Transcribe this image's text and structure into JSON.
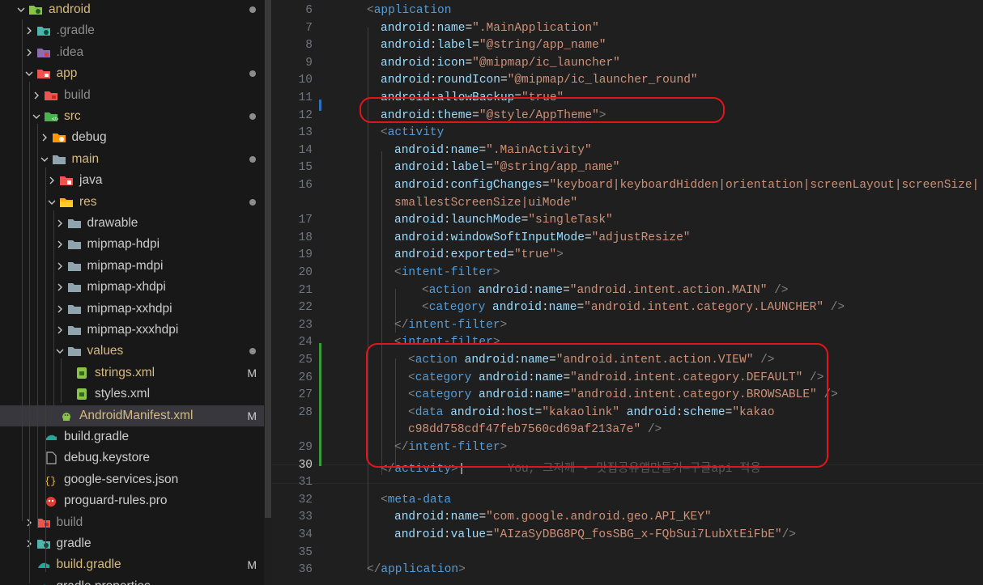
{
  "explorer": {
    "items": [
      {
        "label": "android",
        "color": "#d7ba7d",
        "expanded": true,
        "icon": "android-folder-icon",
        "dot": true
      },
      {
        "label": ".gradle",
        "color": "#8c8c8c",
        "expanded": false,
        "icon": "gradle-folder-icon"
      },
      {
        "label": ".idea",
        "color": "#8c8c8c",
        "expanded": false,
        "icon": "idea-folder-icon"
      },
      {
        "label": "app",
        "color": "#d7ba7d",
        "expanded": true,
        "icon": "app-folder-icon",
        "dot": true
      },
      {
        "label": "build",
        "color": "#8c8c8c",
        "expanded": false,
        "icon": "build-folder-icon"
      },
      {
        "label": "src",
        "color": "#d7ba7d",
        "expanded": true,
        "icon": "src-folder-icon",
        "dot": true
      },
      {
        "label": "debug",
        "color": "#cccccc",
        "expanded": false,
        "icon": "debug-folder-icon"
      },
      {
        "label": "main",
        "color": "#d7ba7d",
        "expanded": true,
        "icon": "folder-icon",
        "dot": true
      },
      {
        "label": "java",
        "color": "#cccccc",
        "expanded": false,
        "icon": "java-folder-icon"
      },
      {
        "label": "res",
        "color": "#d7ba7d",
        "expanded": true,
        "icon": "res-folder-icon",
        "dot": true
      },
      {
        "label": "drawable",
        "color": "#cccccc",
        "expanded": false,
        "icon": "folder-icon"
      },
      {
        "label": "mipmap-hdpi",
        "color": "#cccccc",
        "expanded": false,
        "icon": "folder-icon"
      },
      {
        "label": "mipmap-mdpi",
        "color": "#cccccc",
        "expanded": false,
        "icon": "folder-icon"
      },
      {
        "label": "mipmap-xhdpi",
        "color": "#cccccc",
        "expanded": false,
        "icon": "folder-icon"
      },
      {
        "label": "mipmap-xxhdpi",
        "color": "#cccccc",
        "expanded": false,
        "icon": "folder-icon"
      },
      {
        "label": "mipmap-xxxhdpi",
        "color": "#cccccc",
        "expanded": false,
        "icon": "folder-icon"
      },
      {
        "label": "values",
        "color": "#d7ba7d",
        "expanded": true,
        "icon": "folder-icon",
        "dot": true
      },
      {
        "label": "strings.xml",
        "color": "#d7ba7d",
        "icon": "xml-file-icon",
        "mod": "M"
      },
      {
        "label": "styles.xml",
        "color": "#cccccc",
        "icon": "xml-file-icon"
      },
      {
        "label": "AndroidManifest.xml",
        "color": "#d7ba7d",
        "icon": "android-file-icon",
        "mod": "M",
        "selected": true
      },
      {
        "label": "build.gradle",
        "color": "#cccccc",
        "icon": "gradle-file-icon"
      },
      {
        "label": "debug.keystore",
        "color": "#cccccc",
        "icon": "file-icon"
      },
      {
        "label": "google-services.json",
        "color": "#cccccc",
        "icon": "json-file-icon"
      },
      {
        "label": "proguard-rules.pro",
        "color": "#cccccc",
        "icon": "proguard-file-icon"
      },
      {
        "label": "build",
        "color": "#8c8c8c",
        "expanded": false,
        "icon": "build-folder-icon"
      },
      {
        "label": "gradle",
        "color": "#cccccc",
        "expanded": false,
        "icon": "gradle-folder-icon"
      },
      {
        "label": "build.gradle",
        "color": "#d7ba7d",
        "icon": "gradle-file-icon",
        "mod": "M"
      },
      {
        "label": "gradle.properties",
        "color": "#cccccc",
        "icon": "gradle-file-icon"
      }
    ]
  },
  "editor": {
    "current_line": "30",
    "blame": "You, 그저께 • 맛집공유앱만들기—구글api 적용",
    "lines": [
      {
        "n": "6",
        "tokens": [
          [
            "br",
            "<"
          ],
          [
            "tag",
            "application"
          ]
        ]
      },
      {
        "n": "7",
        "tokens": [
          [
            "ns",
            "android"
          ],
          [
            "eq",
            ":"
          ],
          [
            "attr",
            "name"
          ],
          [
            "eq",
            "="
          ],
          [
            "str",
            "\".MainApplication\""
          ]
        ]
      },
      {
        "n": "8",
        "tokens": [
          [
            "ns",
            "android"
          ],
          [
            "eq",
            ":"
          ],
          [
            "attr",
            "label"
          ],
          [
            "eq",
            "="
          ],
          [
            "str",
            "\"@string/app_name\""
          ]
        ]
      },
      {
        "n": "9",
        "tokens": [
          [
            "ns",
            "android"
          ],
          [
            "eq",
            ":"
          ],
          [
            "attr",
            "icon"
          ],
          [
            "eq",
            "="
          ],
          [
            "str",
            "\"@mipmap/ic_launcher\""
          ]
        ]
      },
      {
        "n": "10",
        "tokens": [
          [
            "ns",
            "android"
          ],
          [
            "eq",
            ":"
          ],
          [
            "attr",
            "roundIcon"
          ],
          [
            "eq",
            "="
          ],
          [
            "str",
            "\"@mipmap/ic_launcher_round\""
          ]
        ]
      },
      {
        "n": "11",
        "tokens": [
          [
            "ns",
            "android"
          ],
          [
            "eq",
            ":"
          ],
          [
            "attr",
            "allowBackup"
          ],
          [
            "eq",
            "="
          ],
          [
            "str",
            "\"true\""
          ]
        ]
      },
      {
        "n": "12",
        "tokens": [
          [
            "ns",
            "android"
          ],
          [
            "eq",
            ":"
          ],
          [
            "attr",
            "theme"
          ],
          [
            "eq",
            "="
          ],
          [
            "str",
            "\"@style/AppTheme\""
          ],
          [
            "br",
            ">"
          ]
        ]
      },
      {
        "n": "13",
        "tokens": [
          [
            "br",
            "<"
          ],
          [
            "tag",
            "activity"
          ]
        ]
      },
      {
        "n": "14",
        "tokens": [
          [
            "ns",
            "android"
          ],
          [
            "eq",
            ":"
          ],
          [
            "attr",
            "name"
          ],
          [
            "eq",
            "="
          ],
          [
            "str",
            "\".MainActivity\""
          ]
        ]
      },
      {
        "n": "15",
        "tokens": [
          [
            "ns",
            "android"
          ],
          [
            "eq",
            ":"
          ],
          [
            "attr",
            "label"
          ],
          [
            "eq",
            "="
          ],
          [
            "str",
            "\"@string/app_name\""
          ]
        ]
      },
      {
        "n": "16",
        "tokens": [
          [
            "ns",
            "android"
          ],
          [
            "eq",
            ":"
          ],
          [
            "attr",
            "configChanges"
          ],
          [
            "eq",
            "="
          ],
          [
            "str",
            "\"keyboard|keyboardHidden|orientation|screenLayout|screenSize|"
          ]
        ]
      },
      {
        "n": "",
        "tokens": [
          [
            "str",
            "smallestScreenSize|uiMode\""
          ]
        ]
      },
      {
        "n": "17",
        "tokens": [
          [
            "ns",
            "android"
          ],
          [
            "eq",
            ":"
          ],
          [
            "attr",
            "launchMode"
          ],
          [
            "eq",
            "="
          ],
          [
            "str",
            "\"singleTask\""
          ]
        ]
      },
      {
        "n": "18",
        "tokens": [
          [
            "ns",
            "android"
          ],
          [
            "eq",
            ":"
          ],
          [
            "attr",
            "windowSoftInputMode"
          ],
          [
            "eq",
            "="
          ],
          [
            "str",
            "\"adjustResize\""
          ]
        ]
      },
      {
        "n": "19",
        "tokens": [
          [
            "ns",
            "android"
          ],
          [
            "eq",
            ":"
          ],
          [
            "attr",
            "exported"
          ],
          [
            "eq",
            "="
          ],
          [
            "str",
            "\"true\""
          ],
          [
            "br",
            ">"
          ]
        ]
      },
      {
        "n": "20",
        "tokens": [
          [
            "br",
            "<"
          ],
          [
            "tag",
            "intent-filter"
          ],
          [
            "br",
            ">"
          ]
        ]
      },
      {
        "n": "21",
        "tokens": [
          [
            "br",
            "<"
          ],
          [
            "tag",
            "action"
          ],
          [
            "eq",
            " "
          ],
          [
            "ns",
            "android"
          ],
          [
            "eq",
            ":"
          ],
          [
            "attr",
            "name"
          ],
          [
            "eq",
            "="
          ],
          [
            "str",
            "\"android.intent.action.MAIN\""
          ],
          [
            "eq",
            " "
          ],
          [
            "br",
            "/>"
          ]
        ]
      },
      {
        "n": "22",
        "tokens": [
          [
            "br",
            "<"
          ],
          [
            "tag",
            "category"
          ],
          [
            "eq",
            " "
          ],
          [
            "ns",
            "android"
          ],
          [
            "eq",
            ":"
          ],
          [
            "attr",
            "name"
          ],
          [
            "eq",
            "="
          ],
          [
            "str",
            "\"android.intent.category.LAUNCHER\""
          ],
          [
            "eq",
            " "
          ],
          [
            "br",
            "/>"
          ]
        ]
      },
      {
        "n": "23",
        "tokens": [
          [
            "br",
            "</"
          ],
          [
            "tag",
            "intent-filter"
          ],
          [
            "br",
            ">"
          ]
        ]
      },
      {
        "n": "24",
        "tokens": [
          [
            "br",
            "<"
          ],
          [
            "tag",
            "intent-filter"
          ],
          [
            "br",
            ">"
          ]
        ]
      },
      {
        "n": "25",
        "tokens": [
          [
            "br",
            "<"
          ],
          [
            "tag",
            "action"
          ],
          [
            "eq",
            " "
          ],
          [
            "ns",
            "android"
          ],
          [
            "eq",
            ":"
          ],
          [
            "attr",
            "name"
          ],
          [
            "eq",
            "="
          ],
          [
            "str",
            "\"android.intent.action.VIEW\""
          ],
          [
            "eq",
            " "
          ],
          [
            "br",
            "/>"
          ]
        ]
      },
      {
        "n": "26",
        "tokens": [
          [
            "br",
            "<"
          ],
          [
            "tag",
            "category"
          ],
          [
            "eq",
            " "
          ],
          [
            "ns",
            "android"
          ],
          [
            "eq",
            ":"
          ],
          [
            "attr",
            "name"
          ],
          [
            "eq",
            "="
          ],
          [
            "str",
            "\"android.intent.category.DEFAULT\""
          ],
          [
            "eq",
            " "
          ],
          [
            "br",
            "/>"
          ]
        ]
      },
      {
        "n": "27",
        "tokens": [
          [
            "br",
            "<"
          ],
          [
            "tag",
            "category"
          ],
          [
            "eq",
            " "
          ],
          [
            "ns",
            "android"
          ],
          [
            "eq",
            ":"
          ],
          [
            "attr",
            "name"
          ],
          [
            "eq",
            "="
          ],
          [
            "str",
            "\"android.intent.category.BROWSABLE\""
          ],
          [
            "eq",
            " "
          ],
          [
            "br",
            "/>"
          ]
        ]
      },
      {
        "n": "28",
        "tokens": [
          [
            "br",
            "<"
          ],
          [
            "tag",
            "data"
          ],
          [
            "eq",
            " "
          ],
          [
            "ns",
            "android"
          ],
          [
            "eq",
            ":"
          ],
          [
            "attr",
            "host"
          ],
          [
            "eq",
            "="
          ],
          [
            "str",
            "\"kakaolink\""
          ],
          [
            "eq",
            " "
          ],
          [
            "ns",
            "android"
          ],
          [
            "eq",
            ":"
          ],
          [
            "attr",
            "scheme"
          ],
          [
            "eq",
            "="
          ],
          [
            "str",
            "\"kakao"
          ]
        ]
      },
      {
        "n": "",
        "tokens": [
          [
            "str",
            "c98dd758cdf47feb7560cd69af213a7e\""
          ],
          [
            "eq",
            " "
          ],
          [
            "br",
            "/>"
          ]
        ]
      },
      {
        "n": "29",
        "tokens": [
          [
            "br",
            "</"
          ],
          [
            "tag",
            "intent-filter"
          ],
          [
            "br",
            ">"
          ]
        ]
      },
      {
        "n": "30",
        "tokens": [
          [
            "br",
            "</"
          ],
          [
            "tag",
            "activity"
          ],
          [
            "br",
            ">"
          ]
        ]
      },
      {
        "n": "31",
        "tokens": []
      },
      {
        "n": "32",
        "tokens": [
          [
            "br",
            "<"
          ],
          [
            "tag",
            "meta-data"
          ]
        ]
      },
      {
        "n": "33",
        "tokens": [
          [
            "ns",
            "android"
          ],
          [
            "eq",
            ":"
          ],
          [
            "attr",
            "name"
          ],
          [
            "eq",
            "="
          ],
          [
            "str",
            "\"com.google.android.geo.API_KEY\""
          ]
        ]
      },
      {
        "n": "34",
        "tokens": [
          [
            "ns",
            "android"
          ],
          [
            "eq",
            ":"
          ],
          [
            "attr",
            "value"
          ],
          [
            "eq",
            "="
          ],
          [
            "str",
            "\"AIzaSyDBG8PQ_fosSBG_x-FQbSui7LubXtEiFbE\""
          ],
          [
            "br",
            "/>"
          ]
        ]
      },
      {
        "n": "35",
        "tokens": []
      },
      {
        "n": "36",
        "tokens": [
          [
            "br",
            "</"
          ],
          [
            "tag",
            "application"
          ],
          [
            "br",
            ">"
          ]
        ]
      }
    ]
  }
}
